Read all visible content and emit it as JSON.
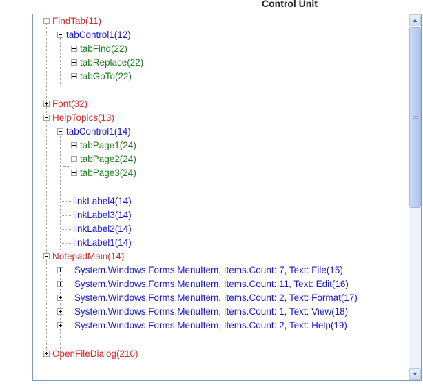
{
  "header": {
    "title": "Control Unit"
  },
  "tree": {
    "nodes": [
      {
        "label": "FindTab(11)",
        "color": "#d42a2a",
        "expanded": true
      },
      {
        "label": "tabControl1(12)",
        "color": "#1a1acc",
        "expanded": true
      },
      {
        "label": "tabFind(22)",
        "color": "#1f7a1f",
        "expanded": false
      },
      {
        "label": "tabReplace(22)",
        "color": "#1f7a1f",
        "expanded": false
      },
      {
        "label": "tabGoTo(22)",
        "color": "#1f7a1f",
        "expanded": false
      },
      {
        "label": "Font(32)",
        "color": "#d42a2a",
        "expanded": false
      },
      {
        "label": "HelpTopics(13)",
        "color": "#d42a2a",
        "expanded": true
      },
      {
        "label": "tabControl1(14)",
        "color": "#1a1acc",
        "expanded": true
      },
      {
        "label": "tabPage1(24)",
        "color": "#1f7a1f",
        "expanded": false
      },
      {
        "label": "tabPage2(24)",
        "color": "#1f7a1f",
        "expanded": false
      },
      {
        "label": "tabPage3(24)",
        "color": "#1f7a1f",
        "expanded": false
      },
      {
        "label": "linkLabel4(14)",
        "color": "#1a1acc"
      },
      {
        "label": "linkLabel3(14)",
        "color": "#1a1acc"
      },
      {
        "label": "linkLabel2(14)",
        "color": "#1a1acc"
      },
      {
        "label": "linkLabel1(14)",
        "color": "#1a1acc"
      },
      {
        "label": "NotepadMain(14)",
        "color": "#d42a2a",
        "expanded": true
      },
      {
        "label": "System.Windows.Forms.MenuItem, Items.Count: 7, Text: File(15)",
        "color": "#1a1acc",
        "expanded": false
      },
      {
        "label": "System.Windows.Forms.MenuItem, Items.Count: 11, Text: Edit(16)",
        "color": "#1a1acc",
        "expanded": false
      },
      {
        "label": "System.Windows.Forms.MenuItem, Items.Count: 2, Text: Format(17)",
        "color": "#1a1acc",
        "expanded": false
      },
      {
        "label": "System.Windows.Forms.MenuItem, Items.Count: 1, Text: View(18)",
        "color": "#1a1acc",
        "expanded": false
      },
      {
        "label": "System.Windows.Forms.MenuItem, Items.Count: 2, Text: Help(19)",
        "color": "#1a1acc",
        "expanded": false
      },
      {
        "label": "OpenFileDialog(210)",
        "color": "#d42a2a",
        "expanded": false
      }
    ]
  },
  "scrollbar": {
    "up_icon": "scroll-up-arrow-icon",
    "down_icon": "scroll-down-arrow-icon"
  }
}
